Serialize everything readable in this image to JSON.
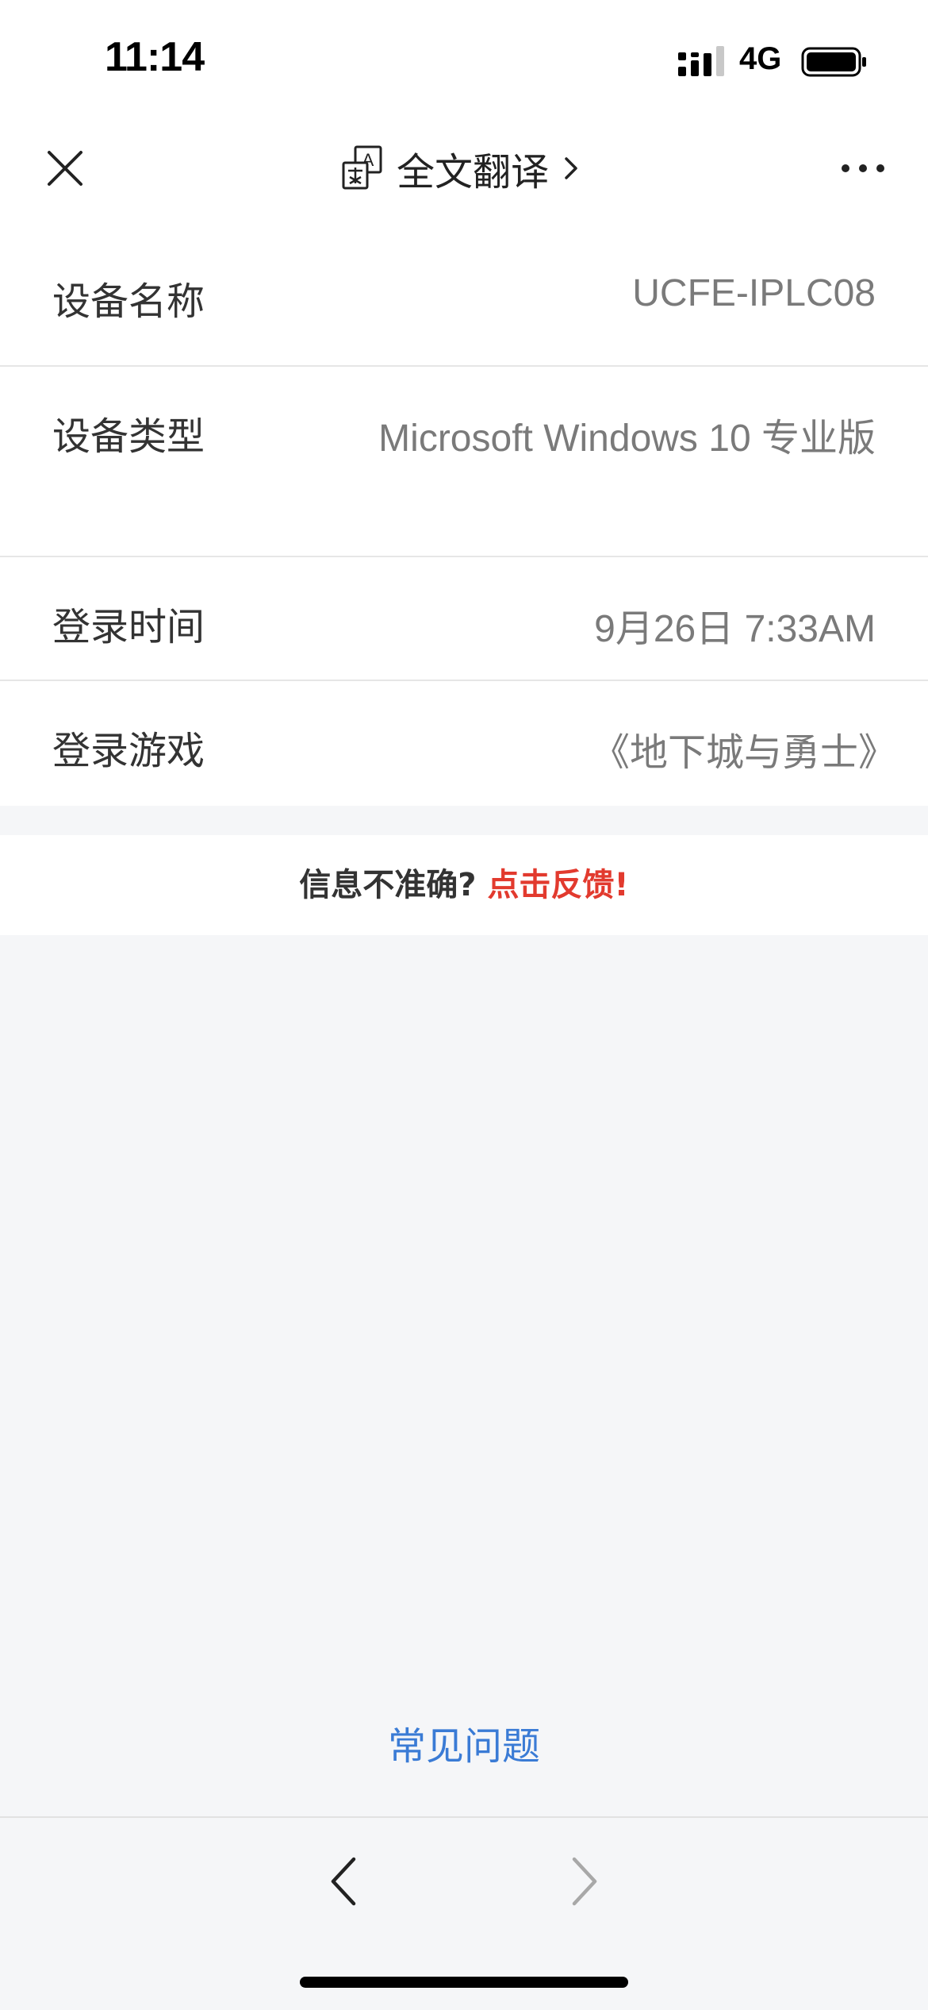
{
  "status_bar": {
    "time": "11:14",
    "network": "4G",
    "signal_icon": "cellular-signal-icon",
    "battery_icon": "battery-icon"
  },
  "nav": {
    "close_icon": "close-icon",
    "translate_label": "全文翻译",
    "translate_icon": "translate-icon",
    "more_icon": "more-icon"
  },
  "info": {
    "rows": [
      {
        "label": "设备名称",
        "value": "UCFE-IPLC08"
      },
      {
        "label": "设备类型",
        "value": "Microsoft Windows 10 专业版"
      },
      {
        "label": "登录时间",
        "value": "9月26日 7:33AM"
      },
      {
        "label": "登录游戏",
        "value": "《地下城与勇士》"
      }
    ]
  },
  "feedback": {
    "question": "信息不准确?",
    "link": "点击反馈!"
  },
  "faq": "常见问题",
  "colors": {
    "accent_red": "#e23a2e",
    "link_blue": "#3a7bd5",
    "page_background": "#f5f6f8"
  }
}
